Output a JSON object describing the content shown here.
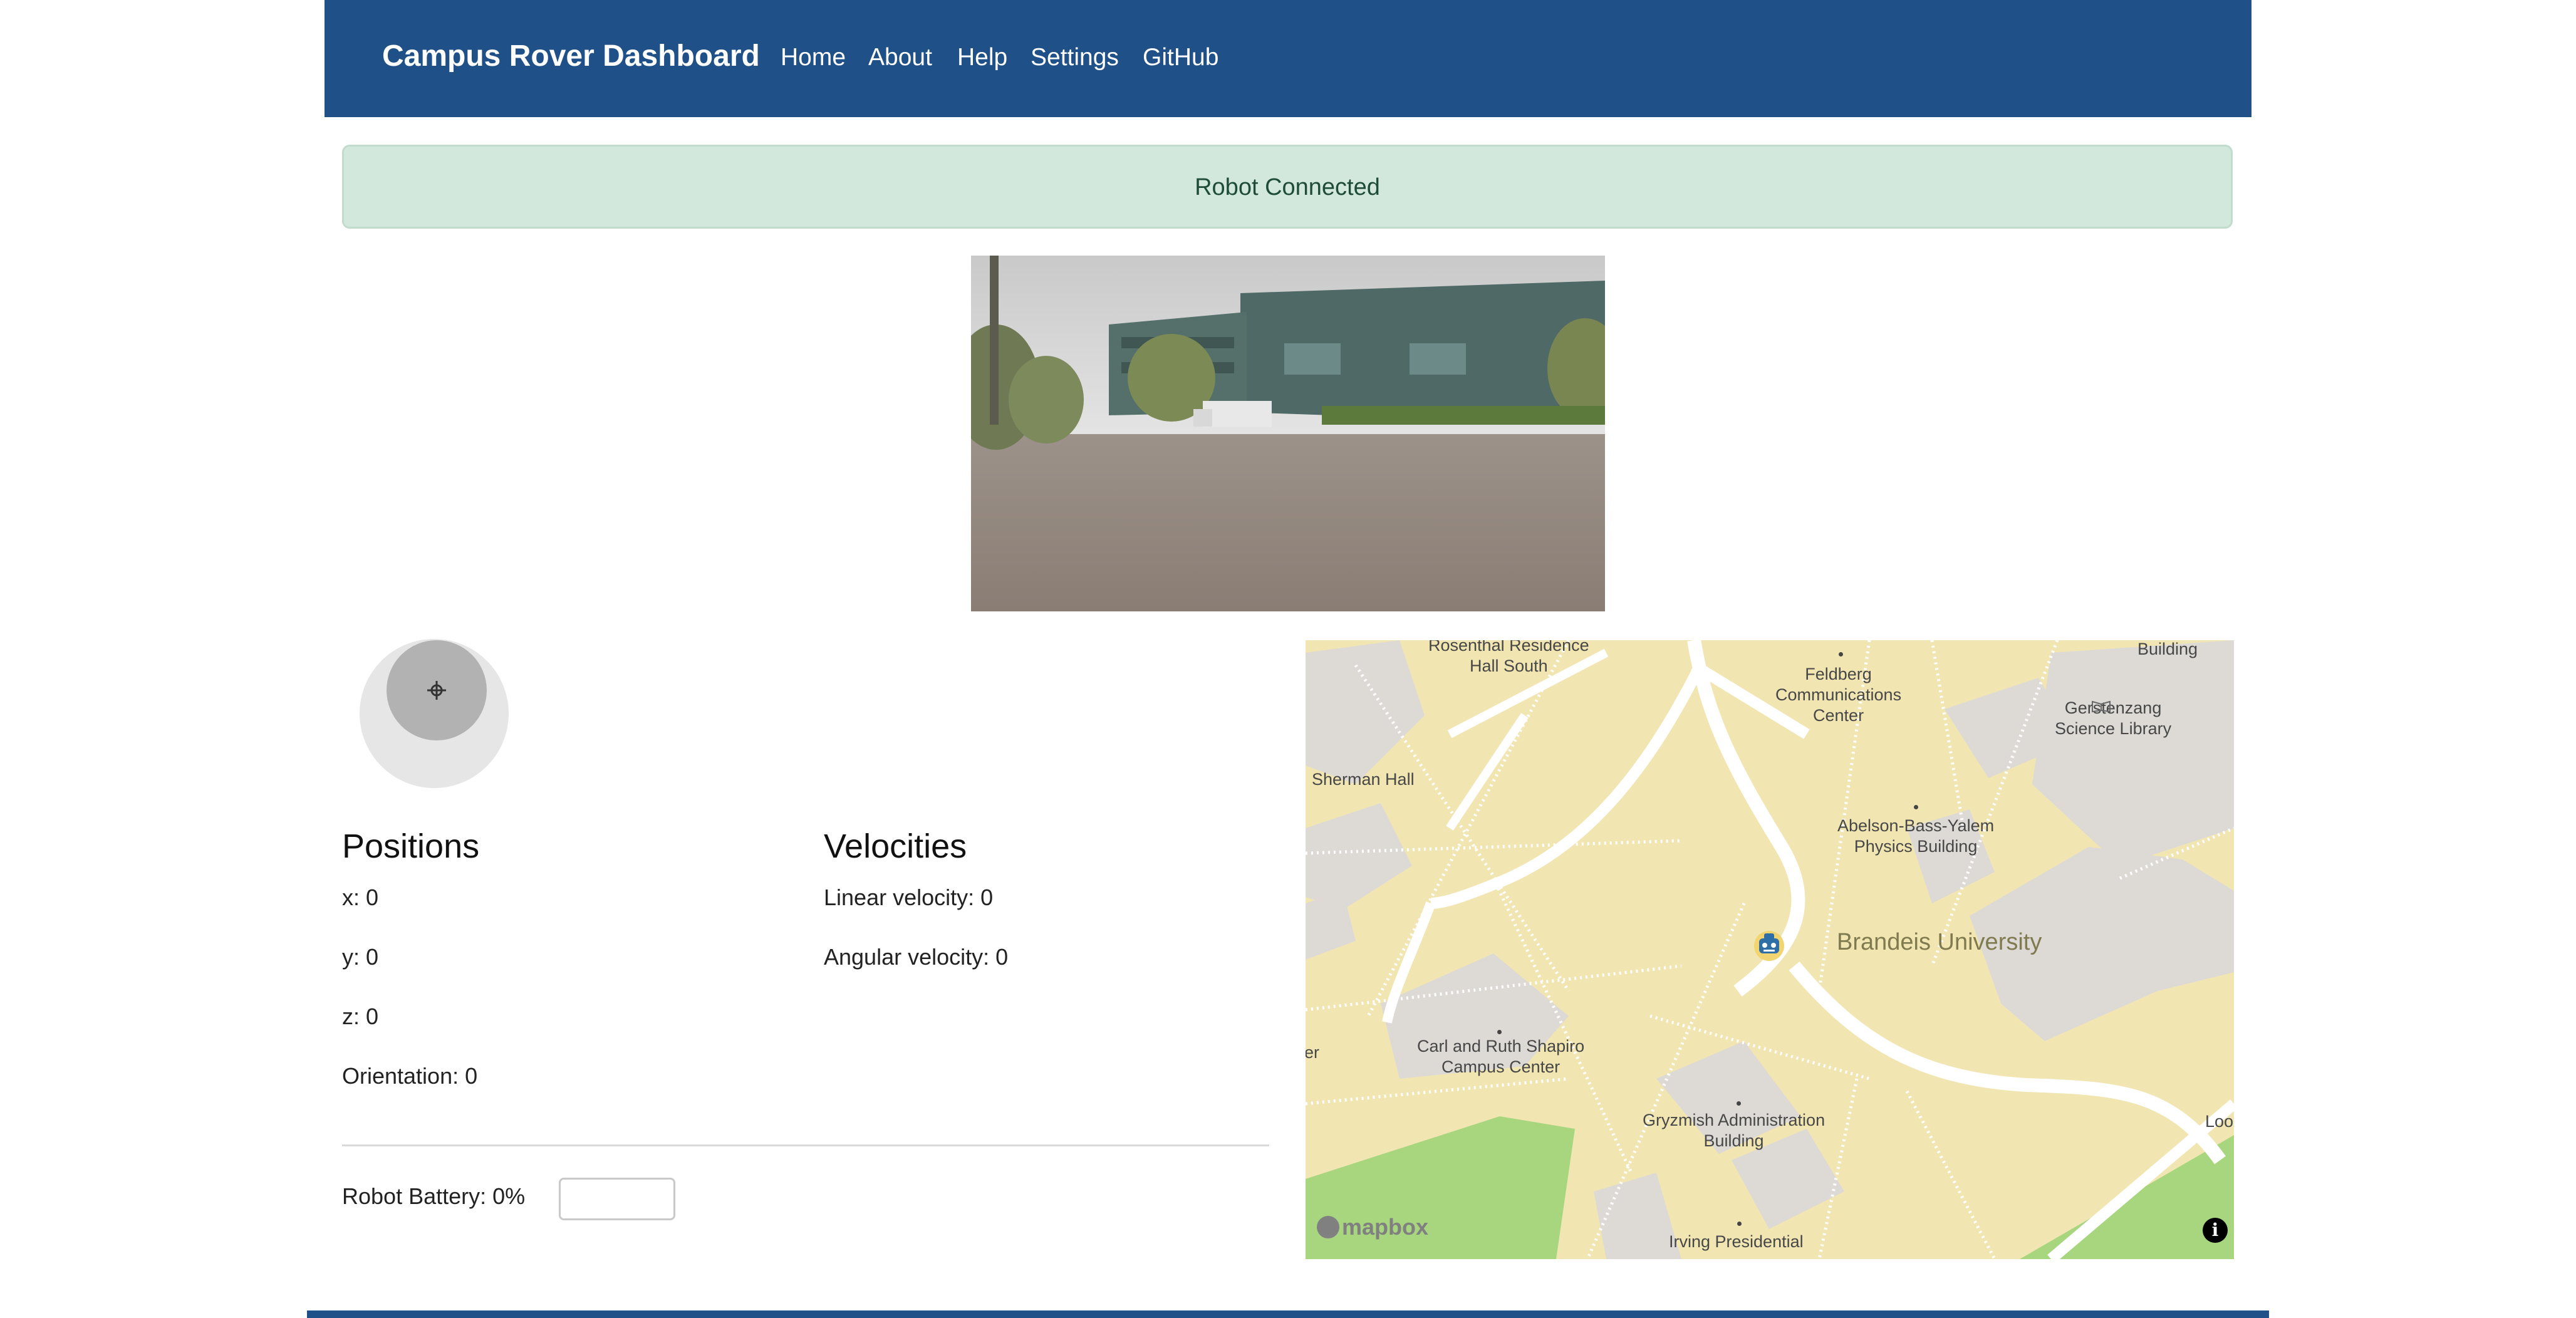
{
  "navbar": {
    "brand": "Campus Rover Dashboard",
    "links": [
      "Home",
      "About",
      "Help",
      "Settings",
      "GitHub"
    ],
    "color": "#1f5088"
  },
  "alert": {
    "text": "Robot Connected",
    "color": "#d3e8dd"
  },
  "positions": {
    "title": "Positions",
    "x": "x: 0",
    "y": "y: 0",
    "z": "z: 0",
    "orientation": "Orientation: 0"
  },
  "velocities": {
    "title": "Velocities",
    "linear": "Linear velocity: 0",
    "angular": "Angular velocity: 0"
  },
  "battery": {
    "label": "Robot Battery: 0%",
    "input_value": ""
  },
  "map": {
    "labels": {
      "rosenthal": "Rosenthal Residence\nHall South",
      "building": "Building",
      "feldberg": "Feldberg\nCommunications\nCenter",
      "gerstenzang": "Gerstenzang\nScience Library",
      "sherman": "Sherman Hall",
      "abelson": "Abelson-Bass-Yalem\nPhysics Building",
      "brandeis": "Brandeis University",
      "shapiro": "Carl and Ruth Shapiro\nCampus Center",
      "er": "er",
      "gryzmish": "Gryzmish Administration\nBuilding",
      "irving": "Irving Presidential",
      "loo": "Loo"
    },
    "attribution": "mapbox",
    "info_icon": "info-icon",
    "robot_icon": "robot-icon"
  },
  "icons": {
    "joystick_center": "move-cross-icon"
  }
}
